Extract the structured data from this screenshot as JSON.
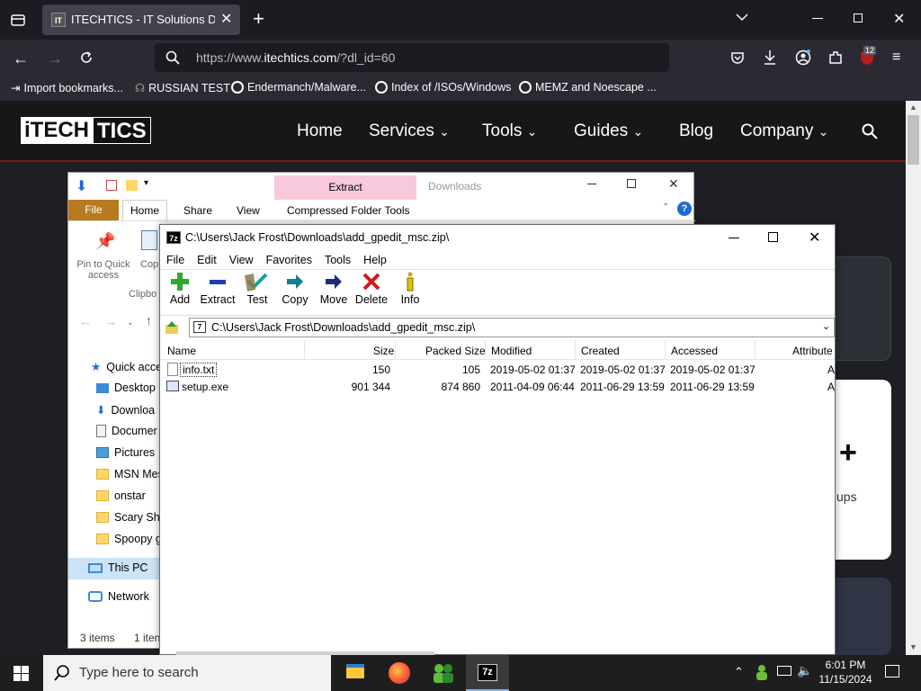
{
  "browser": {
    "tab_title": "ITECHTICS - IT Solutions Design",
    "tab_favicon": "IT",
    "url_prefix": "https://www.",
    "url_domain": "itechtics.com",
    "url_path": "/?dl_id=60",
    "extensions_badge": "12",
    "bookmarks": [
      {
        "label": "Import bookmarks...",
        "icon": "import-icon"
      },
      {
        "label": "RUSSIAN TEST",
        "icon": "headset-icon"
      },
      {
        "label": "Endermanch/Malware...",
        "icon": "google-icon"
      },
      {
        "label": "Index of /ISOs/Windows",
        "icon": "google-icon"
      },
      {
        "label": "MEMZ and Noescape ...",
        "icon": "google-icon"
      }
    ]
  },
  "site": {
    "logo_left": "iTECH",
    "logo_right": "TICS",
    "nav": [
      "Home",
      "Services",
      "Tools",
      "Guides",
      "Blog",
      "Company"
    ],
    "card_text": "ups"
  },
  "explorer": {
    "ribbon_context": "Extract",
    "title": "Downloads",
    "tabs": [
      "File",
      "Home",
      "Share",
      "View",
      "Compressed Folder Tools"
    ],
    "pin_label_1": "Pin to Quick",
    "pin_label_2": "access",
    "copy_label": "Cop",
    "clipboard_label": "Clipbo",
    "sidebar": [
      {
        "label": "Quick acce",
        "icon": "star-icon"
      },
      {
        "label": "Desktop",
        "icon": "desktop-icon"
      },
      {
        "label": "Downloa",
        "icon": "download-icon"
      },
      {
        "label": "Documer",
        "icon": "document-icon"
      },
      {
        "label": "Pictures",
        "icon": "pictures-icon"
      },
      {
        "label": "MSN Mes",
        "icon": "folder-icon"
      },
      {
        "label": "onstar",
        "icon": "folder-icon"
      },
      {
        "label": "Scary Shi",
        "icon": "folder-icon"
      },
      {
        "label": "Spoopy g",
        "icon": "folder-icon"
      },
      {
        "label": "This PC",
        "icon": "pc-icon"
      },
      {
        "label": "Network",
        "icon": "network-icon"
      }
    ],
    "status_items": "3 items",
    "status_selected": "1 iten"
  },
  "zip": {
    "app_icon": "7z",
    "title": "C:\\Users\\Jack Frost\\Downloads\\add_gpedit_msc.zip\\",
    "menu": [
      "File",
      "Edit",
      "View",
      "Favorites",
      "Tools",
      "Help"
    ],
    "toolbar": [
      "Add",
      "Extract",
      "Test",
      "Copy",
      "Move",
      "Delete",
      "Info"
    ],
    "path": "C:\\Users\\Jack Frost\\Downloads\\add_gpedit_msc.zip\\",
    "columns": [
      "Name",
      "Size",
      "Packed Size",
      "Modified",
      "Created",
      "Accessed",
      "Attribute"
    ],
    "rows": [
      {
        "name": "info.txt",
        "size": "150",
        "packed": "105",
        "modified": "2019-05-02 01:37",
        "created": "2019-05-02 01:37",
        "accessed": "2019-05-02 01:37",
        "attr": "A"
      },
      {
        "name": "setup.exe",
        "size": "901 344",
        "packed": "874 860",
        "modified": "2011-04-09 06:44",
        "created": "2011-06-29 13:59",
        "accessed": "2011-06-29 13:59",
        "attr": "A"
      }
    ]
  },
  "taskbar": {
    "search_placeholder": "Type here to search",
    "time": "6:01 PM",
    "date": "11/15/2024",
    "zip_label": "7z"
  }
}
